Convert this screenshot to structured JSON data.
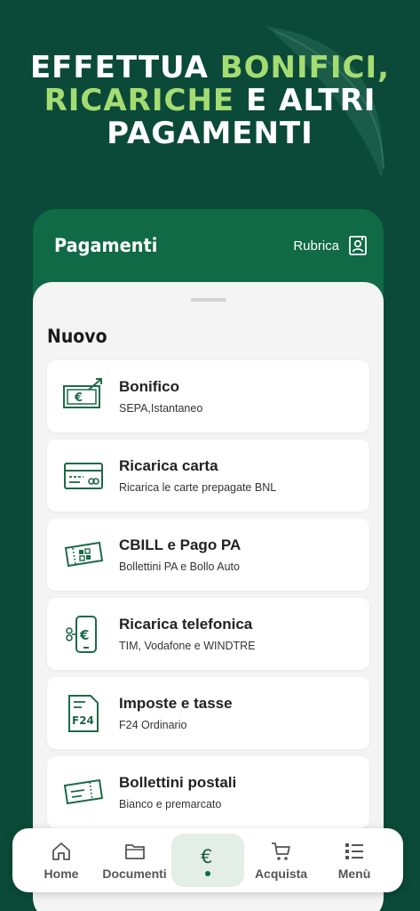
{
  "headline": {
    "line1_white": "EFFETTUA ",
    "line1_green": "BONIFICI,",
    "line2_green": "RICARICHE",
    "line2_white": " E ALTRI",
    "line3_white": "PAGAMENTI"
  },
  "header": {
    "title": "Pagamenti",
    "rubrica_label": "Rubrica"
  },
  "section": {
    "title": "Nuovo"
  },
  "items": [
    {
      "title": "Bonifico",
      "subtitle": "SEPA,Istantaneo",
      "icon": "bank-transfer-icon"
    },
    {
      "title": "Ricarica carta",
      "subtitle": "Ricarica le carte prepagate BNL",
      "icon": "card-topup-icon"
    },
    {
      "title": "CBILL e Pago PA",
      "subtitle": "Bollettini PA e Bollo Auto",
      "icon": "cbill-ticket-icon"
    },
    {
      "title": "Ricarica telefonica",
      "subtitle": "TIM, Vodafone e WINDTRE",
      "icon": "phone-topup-icon"
    },
    {
      "title": "Imposte e tasse",
      "subtitle": "F24 Ordinario",
      "icon": "f24-form-icon"
    },
    {
      "title": "Bollettini postali",
      "subtitle": "Bianco e premarcato",
      "icon": "postal-slip-icon"
    }
  ],
  "tabs": [
    {
      "label": "Home",
      "icon": "home-icon"
    },
    {
      "label": "Documenti",
      "icon": "folder-icon"
    },
    {
      "label": "",
      "icon": "euro-icon",
      "active": true
    },
    {
      "label": "Acquista",
      "icon": "cart-icon"
    },
    {
      "label": "Menù",
      "icon": "menu-list-icon"
    }
  ],
  "colors": {
    "background": "#0b4a38",
    "brand_green": "#0f6a45",
    "accent_light_green": "#a5dc72",
    "icon_green": "#1d6a48"
  }
}
